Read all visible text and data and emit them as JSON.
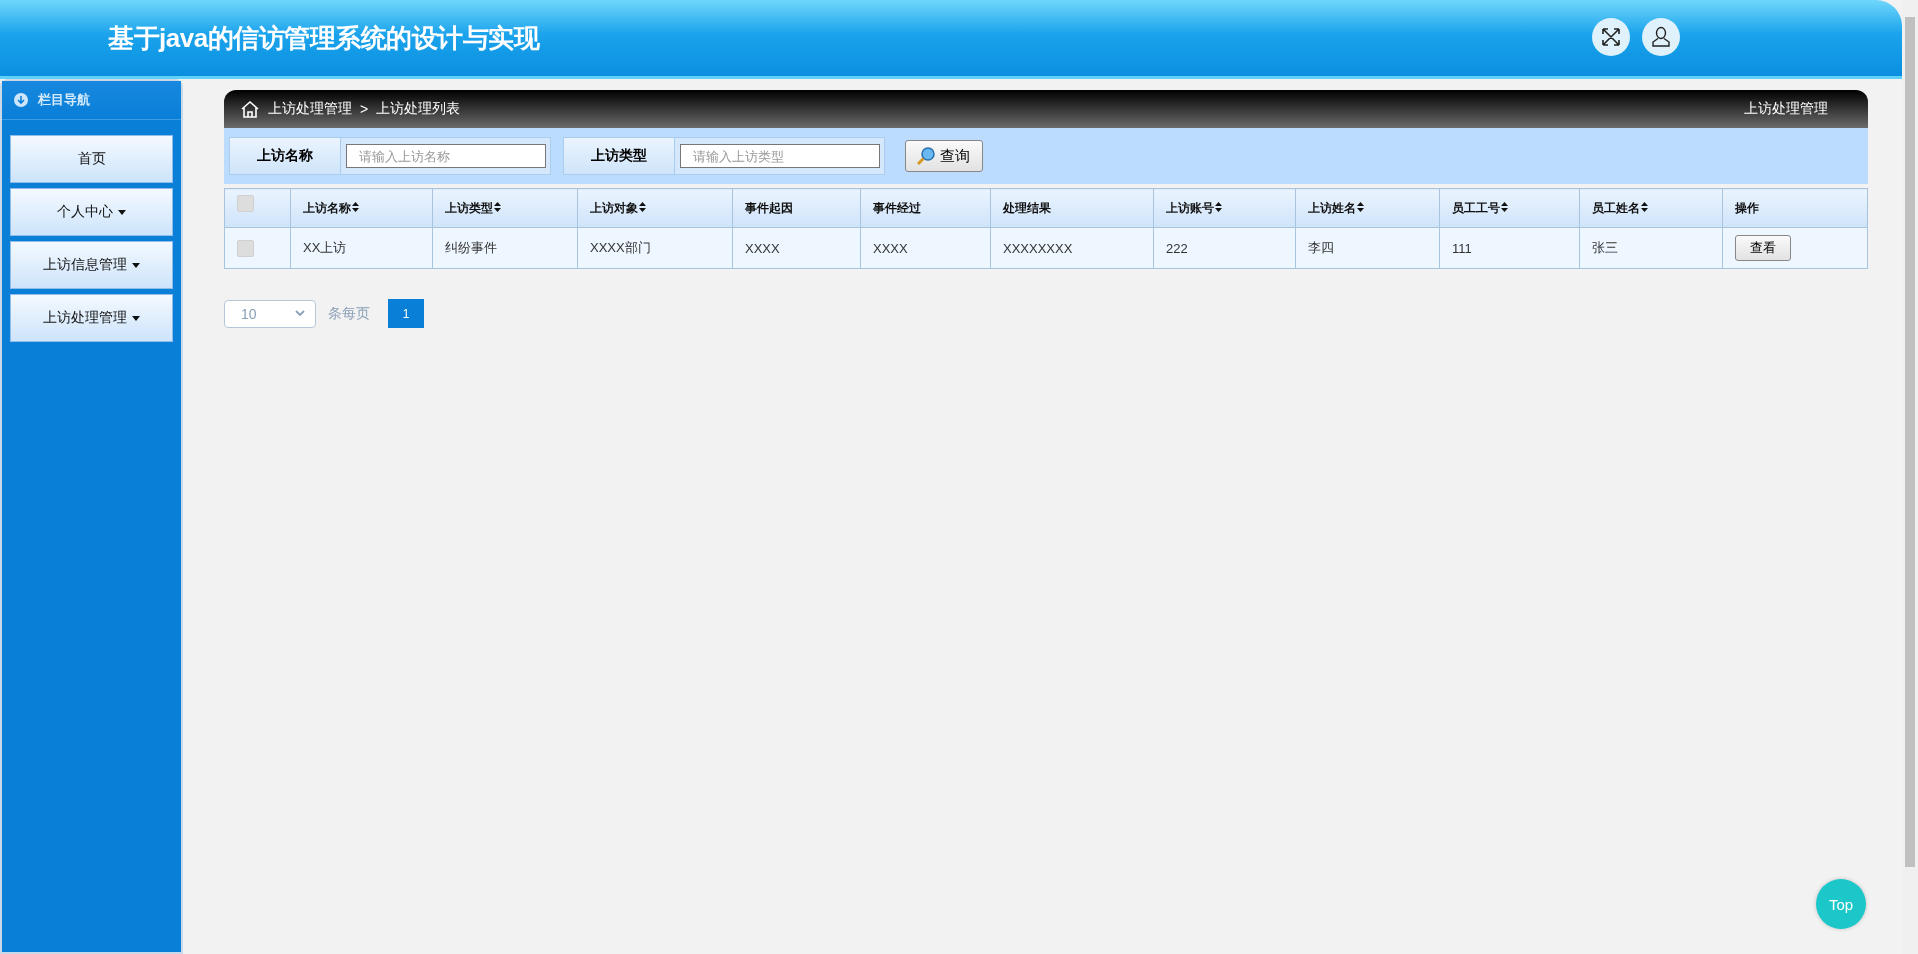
{
  "header": {
    "title": "基于java的信访管理系统的设计与实现"
  },
  "sidebar": {
    "title": "栏目导航",
    "items": [
      {
        "label": "首页",
        "has_menu": false
      },
      {
        "label": "个人中心",
        "has_menu": true
      },
      {
        "label": "上访信息管理",
        "has_menu": true
      },
      {
        "label": "上访处理管理",
        "has_menu": true
      }
    ]
  },
  "breadcrumb": {
    "items": [
      "上访处理管理",
      "上访处理列表"
    ],
    "separator": ">",
    "page_title": "上访处理管理"
  },
  "search": {
    "fields": [
      {
        "label": "上访名称",
        "placeholder": "请输入上访名称"
      },
      {
        "label": "上访类型",
        "placeholder": "请输入上访类型"
      }
    ],
    "button": "查询"
  },
  "table": {
    "select_all_checked": false,
    "columns": [
      {
        "label": "上访名称",
        "sortable": true
      },
      {
        "label": "上访类型",
        "sortable": true
      },
      {
        "label": "上访对象",
        "sortable": true
      },
      {
        "label": "事件起因",
        "sortable": false
      },
      {
        "label": "事件经过",
        "sortable": false
      },
      {
        "label": "处理结果",
        "sortable": false
      },
      {
        "label": "上访账号",
        "sortable": true
      },
      {
        "label": "上访姓名",
        "sortable": true
      },
      {
        "label": "员工工号",
        "sortable": true
      },
      {
        "label": "员工姓名",
        "sortable": true
      },
      {
        "label": "操作",
        "sortable": false
      }
    ],
    "rows": [
      {
        "checked": false,
        "cells": [
          "XX上访",
          "纠纷事件",
          "XXXX部门",
          "XXXX",
          "XXXX",
          "XXXXXXXX",
          "222",
          "李四",
          "111",
          "张三"
        ],
        "action": "查看"
      }
    ]
  },
  "pagination": {
    "page_size": "10",
    "page_size_label": "条每页",
    "pages": [
      {
        "label": "1",
        "selected": true
      }
    ]
  },
  "top_button": "Top"
}
